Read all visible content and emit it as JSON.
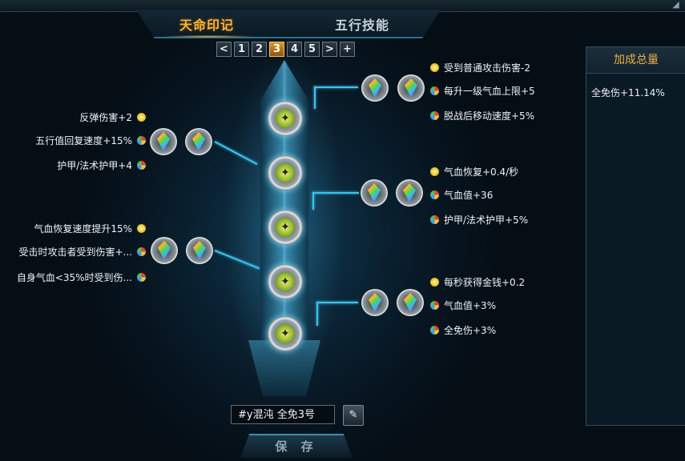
{
  "tabs": {
    "active": "天命印记",
    "inactive": "五行技能"
  },
  "pager": {
    "prev": "<",
    "pages": [
      "1",
      "2",
      "3",
      "4",
      "5"
    ],
    "active_page": "3",
    "next": ">",
    "add": "+"
  },
  "left_groups": [
    {
      "attrs": [
        {
          "text": "反弹伤害+2",
          "icon": "coin-icon"
        },
        {
          "text": "五行值回复速度+15%",
          "icon": "element-icon"
        },
        {
          "text": "护甲/法术护甲+4",
          "icon": "element-icon"
        }
      ]
    },
    {
      "attrs": [
        {
          "text": "气血恢复速度提升15%",
          "icon": "coin-icon"
        },
        {
          "text": "受击时攻击者受到伤害+...",
          "icon": "element-icon"
        },
        {
          "text": "自身气血<35%时受到伤...",
          "icon": "element-icon"
        }
      ]
    }
  ],
  "right_groups": [
    {
      "attrs": [
        {
          "text": "受到普通攻击伤害-2",
          "icon": "coin-icon"
        },
        {
          "text": "每升一级气血上限+5",
          "icon": "element-icon"
        },
        {
          "text": "脱战后移动速度+5%",
          "icon": "element-icon"
        }
      ]
    },
    {
      "attrs": [
        {
          "text": "气血恢复+0.4/秒",
          "icon": "coin-icon"
        },
        {
          "text": "气血值+36",
          "icon": "element-icon"
        },
        {
          "text": "护甲/法术护甲+5%",
          "icon": "element-icon"
        }
      ]
    },
    {
      "attrs": [
        {
          "text": "每秒获得金钱+0.2",
          "icon": "coin-icon"
        },
        {
          "text": "气血值+3%",
          "icon": "element-icon"
        },
        {
          "text": "全免伤+3%",
          "icon": "element-icon"
        }
      ]
    }
  ],
  "summary": {
    "title": "加成总量",
    "text": "全免伤+11.14%"
  },
  "preset_name": "#y混沌 全免3号",
  "save_label": "保 存",
  "colors": {
    "accent": "#f7b33a",
    "line": "#3ac3ef",
    "panel_title": "#e9b24a"
  }
}
